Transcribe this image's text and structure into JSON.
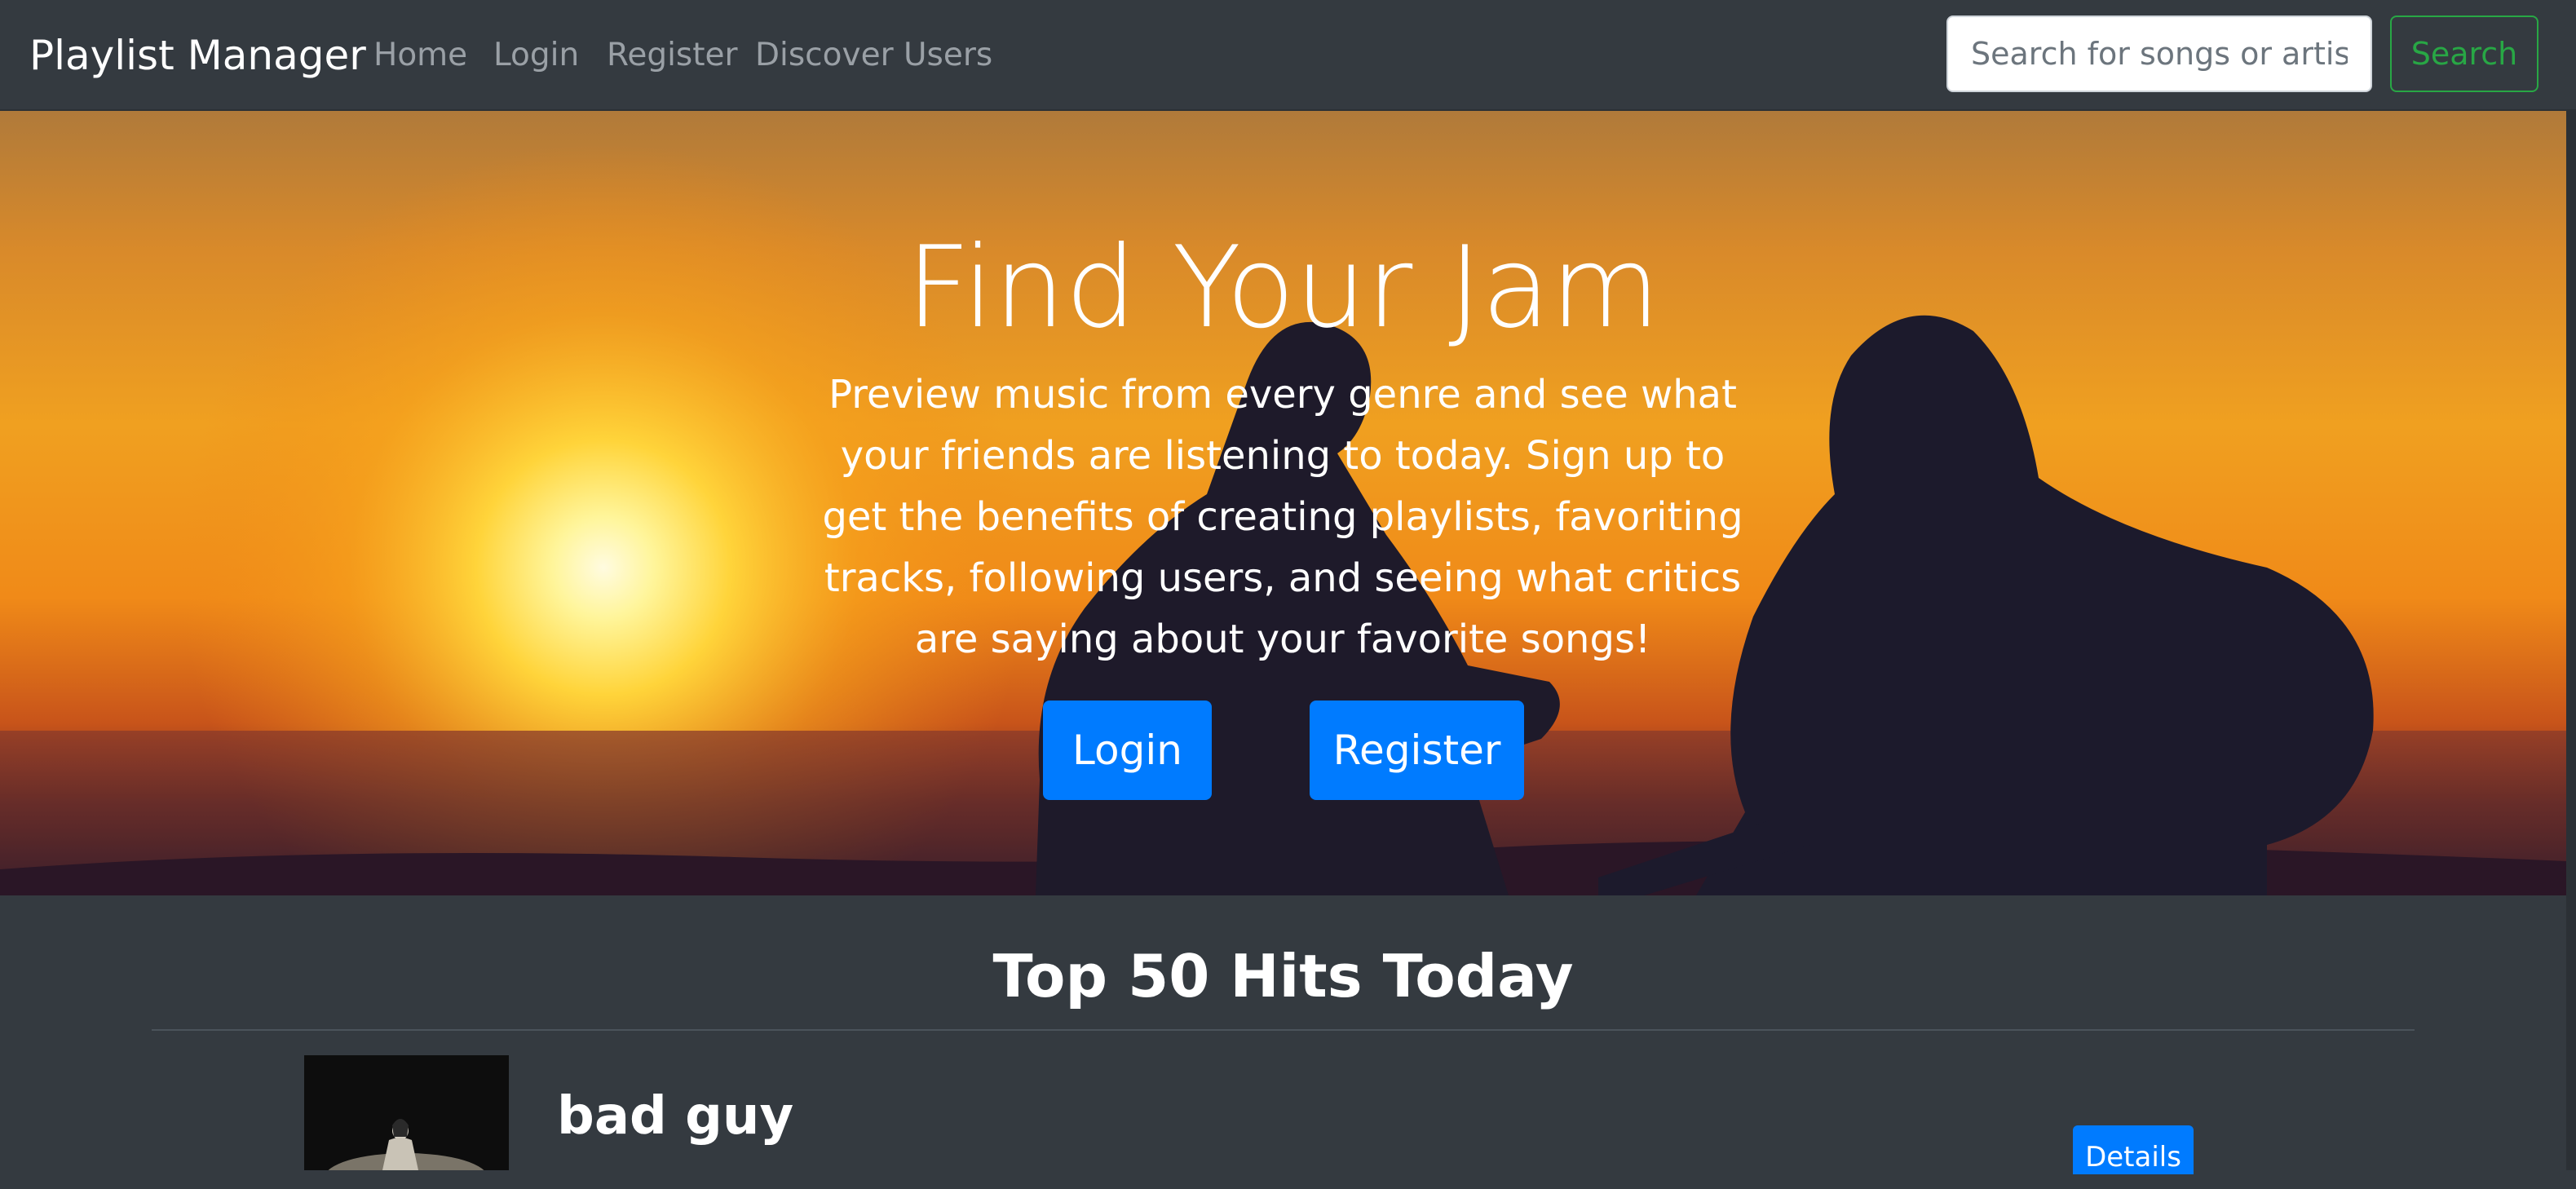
{
  "navbar": {
    "brand": "Playlist Manager",
    "links": [
      "Home",
      "Login",
      "Register",
      "Discover Users"
    ],
    "search_placeholder": "Search for songs or artists",
    "search_button": "Search"
  },
  "hero": {
    "title": "Find Your Jam",
    "description": "Preview music from every genre and see what your friends are listening to today. Sign up to get the benefits of creating playlists, favoriting tracks, following users, and seeing what critics are saying about your favorite songs!",
    "login_button": "Login",
    "register_button": "Register"
  },
  "top_hits": {
    "heading": "Top 50 Hits Today",
    "tracks": [
      {
        "title": "bad guy",
        "details_button": "Details"
      }
    ]
  },
  "colors": {
    "navbar_bg": "#343a40",
    "primary": "#007bff",
    "success": "#28a745"
  }
}
